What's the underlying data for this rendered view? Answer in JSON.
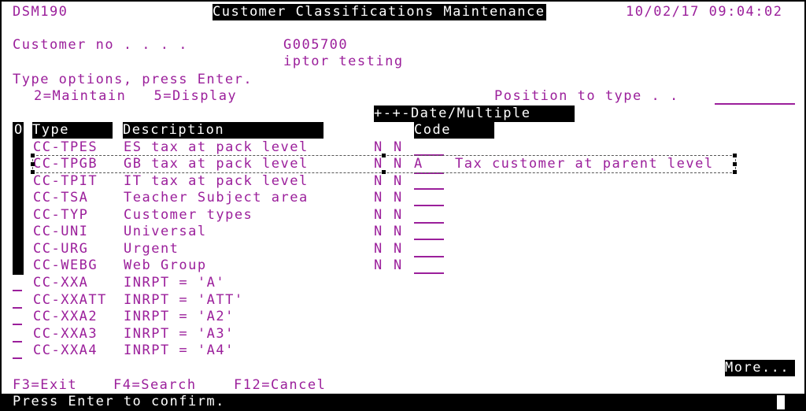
{
  "header": {
    "program": "DSM190",
    "title": "Customer Classifications Maintenance",
    "datetime": "10/02/17 09:04:02"
  },
  "customer": {
    "label": "Customer no . . . .",
    "number": "G005700",
    "name": "iptor testing"
  },
  "instructions": {
    "line1": "Type options, press Enter.",
    "options": "2=Maintain   5=Display"
  },
  "position": {
    "label": "Position to type . .",
    "value": ""
  },
  "columns": {
    "date_multiple": "+-+-Date/Multiple",
    "opt": "O",
    "type": "Type",
    "description": "Description",
    "code": "Code"
  },
  "rows": [
    {
      "opt": "",
      "type": "CC-TPES",
      "description": "ES tax at pack level",
      "f1": "N",
      "f2": "N",
      "code": "",
      "code_desc": ""
    },
    {
      "opt": "",
      "type": "CC-TPGB",
      "description": "GB tax at pack level",
      "f1": "N",
      "f2": "N",
      "code": "A",
      "code_desc": "Tax customer at parent level"
    },
    {
      "opt": "",
      "type": "CC-TPIT",
      "description": "IT tax at pack level",
      "f1": "N",
      "f2": "N",
      "code": "",
      "code_desc": ""
    },
    {
      "opt": "",
      "type": "CC-TSA",
      "description": "Teacher Subject area",
      "f1": "N",
      "f2": "N",
      "code": "",
      "code_desc": ""
    },
    {
      "opt": "",
      "type": "CC-TYP",
      "description": "Customer types",
      "f1": "N",
      "f2": "N",
      "code": "",
      "code_desc": ""
    },
    {
      "opt": "",
      "type": "CC-UNI",
      "description": "Universal",
      "f1": "N",
      "f2": "N",
      "code": "",
      "code_desc": ""
    },
    {
      "opt": "",
      "type": "CC-URG",
      "description": "Urgent",
      "f1": "N",
      "f2": "N",
      "code": "",
      "code_desc": ""
    },
    {
      "opt": "",
      "type": "CC-WEBG",
      "description": "Web Group",
      "f1": "N",
      "f2": "N",
      "code": "",
      "code_desc": ""
    },
    {
      "opt": "",
      "type": "CC-XXA",
      "description": "INRPT = 'A'"
    },
    {
      "opt": "",
      "type": "CC-XXATT",
      "description": "INRPT = 'ATT'"
    },
    {
      "opt": "",
      "type": "CC-XXA2",
      "description": "INRPT = 'A2'"
    },
    {
      "opt": "",
      "type": "CC-XXA3",
      "description": "INRPT = 'A3'"
    },
    {
      "opt": "",
      "type": "CC-XXA4",
      "description": "INRPT = 'A4'"
    }
  ],
  "more": "More...",
  "function_keys": [
    "F3=Exit",
    "F4=Search",
    "F12=Cancel"
  ],
  "message": "Press Enter to confirm.",
  "colors": {
    "text": "#9b1f9b",
    "inverse_bg": "#000000",
    "inverse_fg": "#ffffff"
  }
}
